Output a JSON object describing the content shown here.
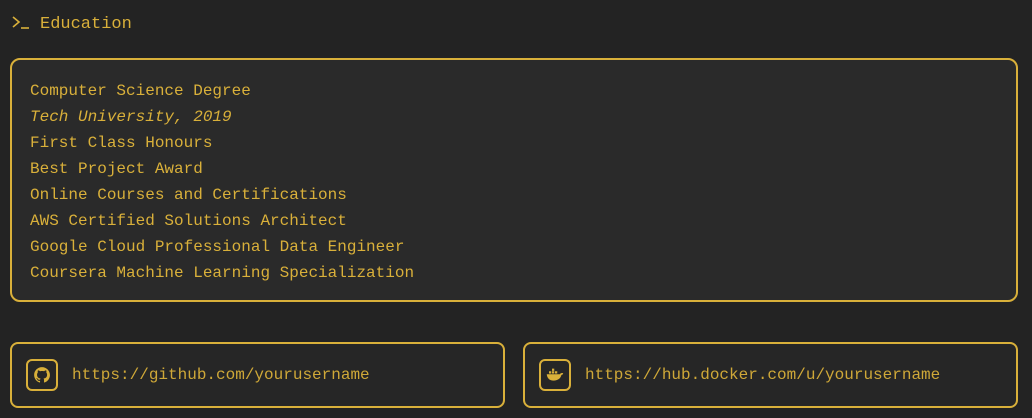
{
  "section": {
    "icon": "terminal-prompt-icon",
    "title": "Education"
  },
  "education": {
    "lines": [
      "Computer Science Degree",
      "Tech University, 2019",
      "First Class Honours",
      "Best Project Award",
      "Online Courses and Certifications",
      "AWS Certified Solutions Architect",
      "Google Cloud Professional Data Engineer",
      "Coursera Machine Learning Specialization"
    ]
  },
  "links": {
    "github": {
      "icon": "github-icon",
      "url": "https://github.com/yourusername"
    },
    "docker": {
      "icon": "docker-icon",
      "url": "https://hub.docker.com/u/yourusername"
    }
  },
  "colors": {
    "accent": "#d9b03a",
    "background": "#232323",
    "card": "#2a2a2a"
  }
}
